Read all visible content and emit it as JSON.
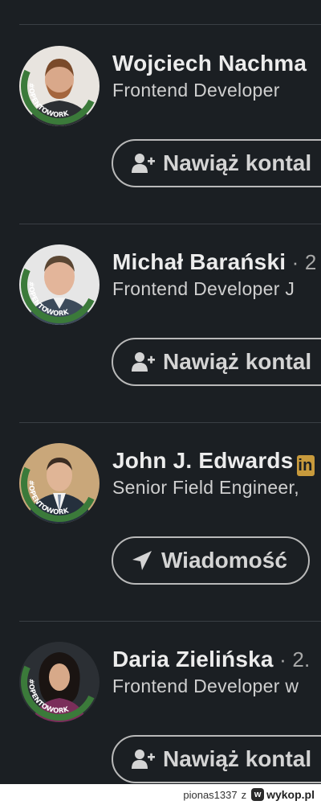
{
  "people": [
    {
      "name": "Wojciech Nachma",
      "degree": "",
      "headline": "Frontend Developer",
      "action_label": "Nawiąż kontal",
      "action_icon": "add-person-icon",
      "avatar_badge": "#OPENTOWORK"
    },
    {
      "name": "Michał Barański",
      "degree": " · 2",
      "headline": "Frontend Developer J",
      "action_label": "Nawiąż kontal",
      "action_icon": "add-person-icon",
      "avatar_badge": "#OPENTOWORK"
    },
    {
      "name": "John J. Edwards",
      "degree": "",
      "badge": "in",
      "headline": "Senior Field Engineer,",
      "action_label": "Wiadomość",
      "action_icon": "send-icon",
      "avatar_badge": "#OPENTOWORK"
    },
    {
      "name": "Daria Zielińska",
      "degree": " · 2.",
      "headline": "Frontend Developer w",
      "action_label": "Nawiąż kontal",
      "action_icon": "add-person-icon",
      "avatar_badge": "#OPENTOWORK"
    }
  ],
  "footer": {
    "user": "pionas1337",
    "separator": "z",
    "logo": "w",
    "site": "wykop.pl"
  },
  "colors": {
    "background": "#1b1f23",
    "opentowork_green": "#3b7a3a",
    "button_border": "#b9b9b9",
    "premium_badge": "#c89a3c"
  }
}
